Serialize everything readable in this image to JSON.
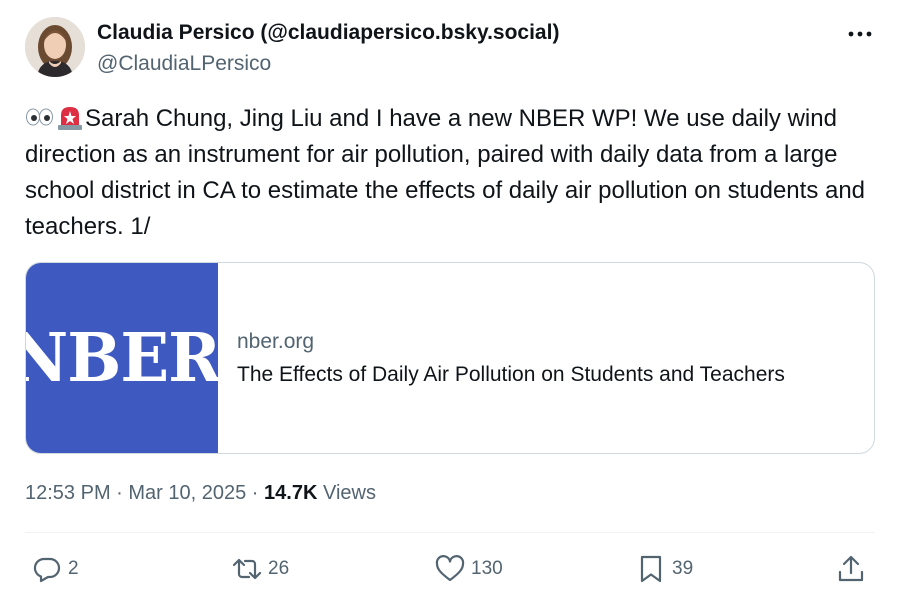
{
  "author": {
    "display_name": "Claudia Persico (@claudiapersico.bsky.social)",
    "handle": "@ClaudiaLPersico"
  },
  "tweet": {
    "text": "Sarah Chung, Jing Liu and I have a new NBER WP! We use daily wind direction as an instrument for air pollution, paired with daily data from a large school district in CA to estimate the effects of daily air pollution on students and teachers. 1/",
    "emojis": [
      "eyes-emoji",
      "rotating-light-emoji"
    ]
  },
  "card": {
    "image_text": "NBER",
    "domain": "nber.org",
    "title": "The Effects of Daily Air Pollution on Students and Teachers"
  },
  "meta": {
    "time": "12:53 PM",
    "separator1": " · ",
    "date": "Mar 10, 2025",
    "separator2": " · ",
    "views_count": "14.7K",
    "views_label": " Views"
  },
  "actions": {
    "replies": "2",
    "reposts": "26",
    "likes": "130",
    "bookmarks": "39"
  },
  "colors": {
    "text_primary": "#0f1419",
    "text_secondary": "#536471",
    "card_image_bg": "#3e59c0",
    "border": "#cfd9de"
  }
}
